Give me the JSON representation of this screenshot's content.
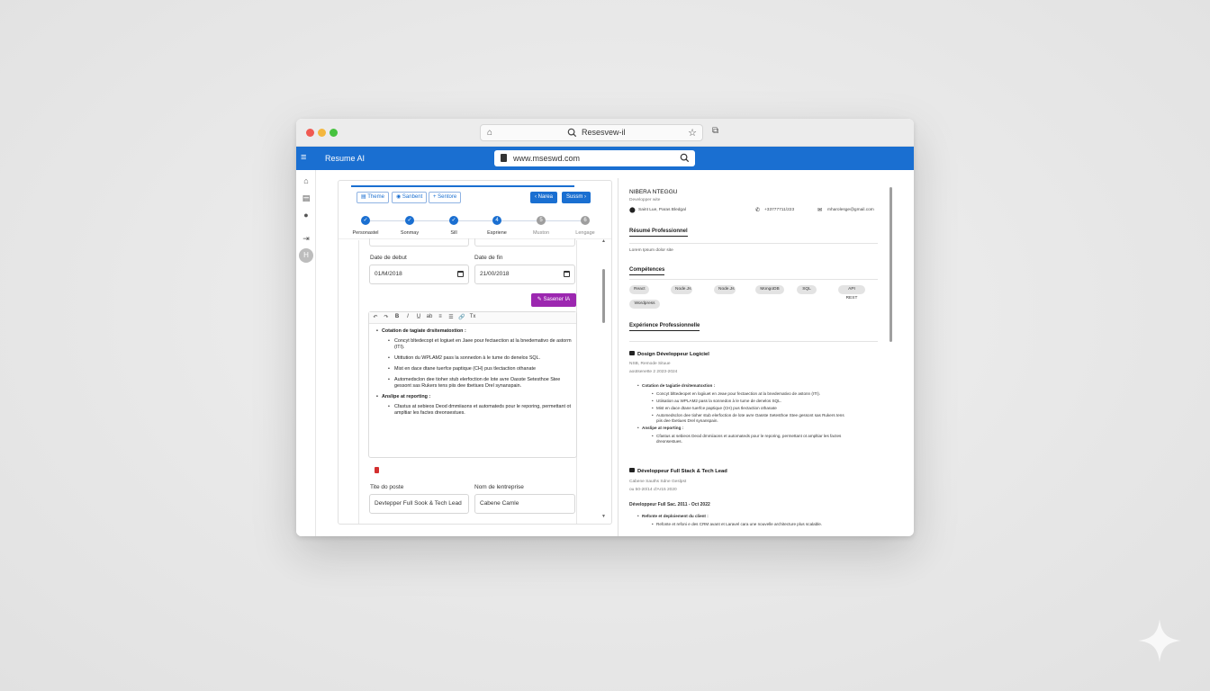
{
  "browser": {
    "tab_title": "Resesvew-il"
  },
  "app": {
    "brand": "Resume AI",
    "url": "www.mseswd.com"
  },
  "rail": {
    "avatar_initial": "H"
  },
  "editor": {
    "toolbar": {
      "btn1": "Theme",
      "btn2": "Sanbent",
      "btn3": "+ Sentore",
      "prev": "‹ Narea",
      "next": "Sussm ›"
    },
    "steps": [
      {
        "label": "Personastel",
        "state": "done"
      },
      {
        "label": "Sonmay",
        "state": "done"
      },
      {
        "label": "Sill",
        "state": "done"
      },
      {
        "label": "Espriene",
        "state": "current",
        "num": "4"
      },
      {
        "label": "Muston",
        "state": "off",
        "num": "5"
      },
      {
        "label": "Lengage",
        "state": "off",
        "num": "6"
      }
    ],
    "date_start_label": "Date de debut",
    "date_start_value": "01/M/2018",
    "date_end_label": "Date de fin",
    "date_end_value": "21/00/2018",
    "ai_button": "Sasener IA",
    "rte_tools": [
      "↶",
      "↷",
      "B",
      "I",
      "U̲",
      "ab",
      "≡",
      "☰",
      "🔗",
      "Tx"
    ],
    "description": {
      "h1": "Cotation de tagiate drsitematoxtion :",
      "b1": "Concyt bltedecopt et logiuet en Jaee pour fectaection at la bnedemativo de astorm (ITI).",
      "b2": "Utittution du WPLAM2 pass la sonnedon à le tume do denelos SQL.",
      "b3": "Mist en dace dtane tuerfce paptique (CH) pus tlectaction othanate",
      "b4": "Automedsclon dee tioher stub elerfoction de lote avre Oasste Setesthoe Stee gessont sas Rukers tens piis dee tbetiues Drel synanspain.",
      "h2": "Anslipe at reporting :",
      "b5": "Cfastus at sebieos Deod dmmiiaons et automateds pour le reporing, permettant ot ampltiar les factes dreonsestues."
    },
    "job_title_label": "Tite do poste",
    "job_title_value": "Devtepper Full Sook & Tech Lead",
    "company_label": "Nom de lentreprise",
    "company_value": "Cabene Camle"
  },
  "preview": {
    "name": "NIBERA NTEGGU",
    "subtitle": "Developper wite",
    "location": "Saint Lue, Paras Bledgal",
    "phone": "+33777711/223",
    "email": "mharolesge@gmail.com",
    "profile_heading": "Résumé Professionnel",
    "profile_text": "Lorem Ipsum dolor site",
    "skills_heading": "Compétences",
    "skills": [
      "React",
      "Node.Js",
      "Node.Js",
      "MongoDB",
      "SQL",
      "API REST",
      "Wordpress"
    ],
    "exp_heading": "Expérience Professionnelle",
    "job1": {
      "title": "Dosign Développeur Logiciel",
      "company": "NSB, Remode Situue",
      "dates": "aoütsenette 2 2023-2024",
      "h1": "Cotation de tagiatie drsitematoxtion :",
      "b1": "Concyt blttedeopet en logiiuet en Jeae pour fectaection at la bnedemativo de astonn (ITI).",
      "b2": "Utiisation au WPLAM2 pass la sonnedon à le tume de denelos SQL.",
      "b3": "Mist en dace dtane tuerfce paptique (CH) pus tlectaction othanate",
      "b4": "Automedsclon dee tioher stub elerfoction de lote avre Oasste Setesthoe Stee gessont sas Rukers tens piis dee tbetiues Drel synanspain.",
      "h2": "Anslipe at reporting :",
      "b5": "Cfastus at sebieos Deod dmmiiaons et automateds pour le reporing, permettant ot ampltiar les factes dreonsestues."
    },
    "job2": {
      "title": "Développeur Full Stack & Tech Lead",
      "company": "Cabene Sauths Sdne Geslpst",
      "dates": "ou 50-20/14 d'Ar15 2020",
      "role": "Développeur Full Sac. 2011 - Oct 2022",
      "h1": "Refonte et deploiement du client :",
      "b1": "Refonte et refoni e des CRM avant et Laravel cara une nouvelle architecture plus scalable."
    }
  }
}
